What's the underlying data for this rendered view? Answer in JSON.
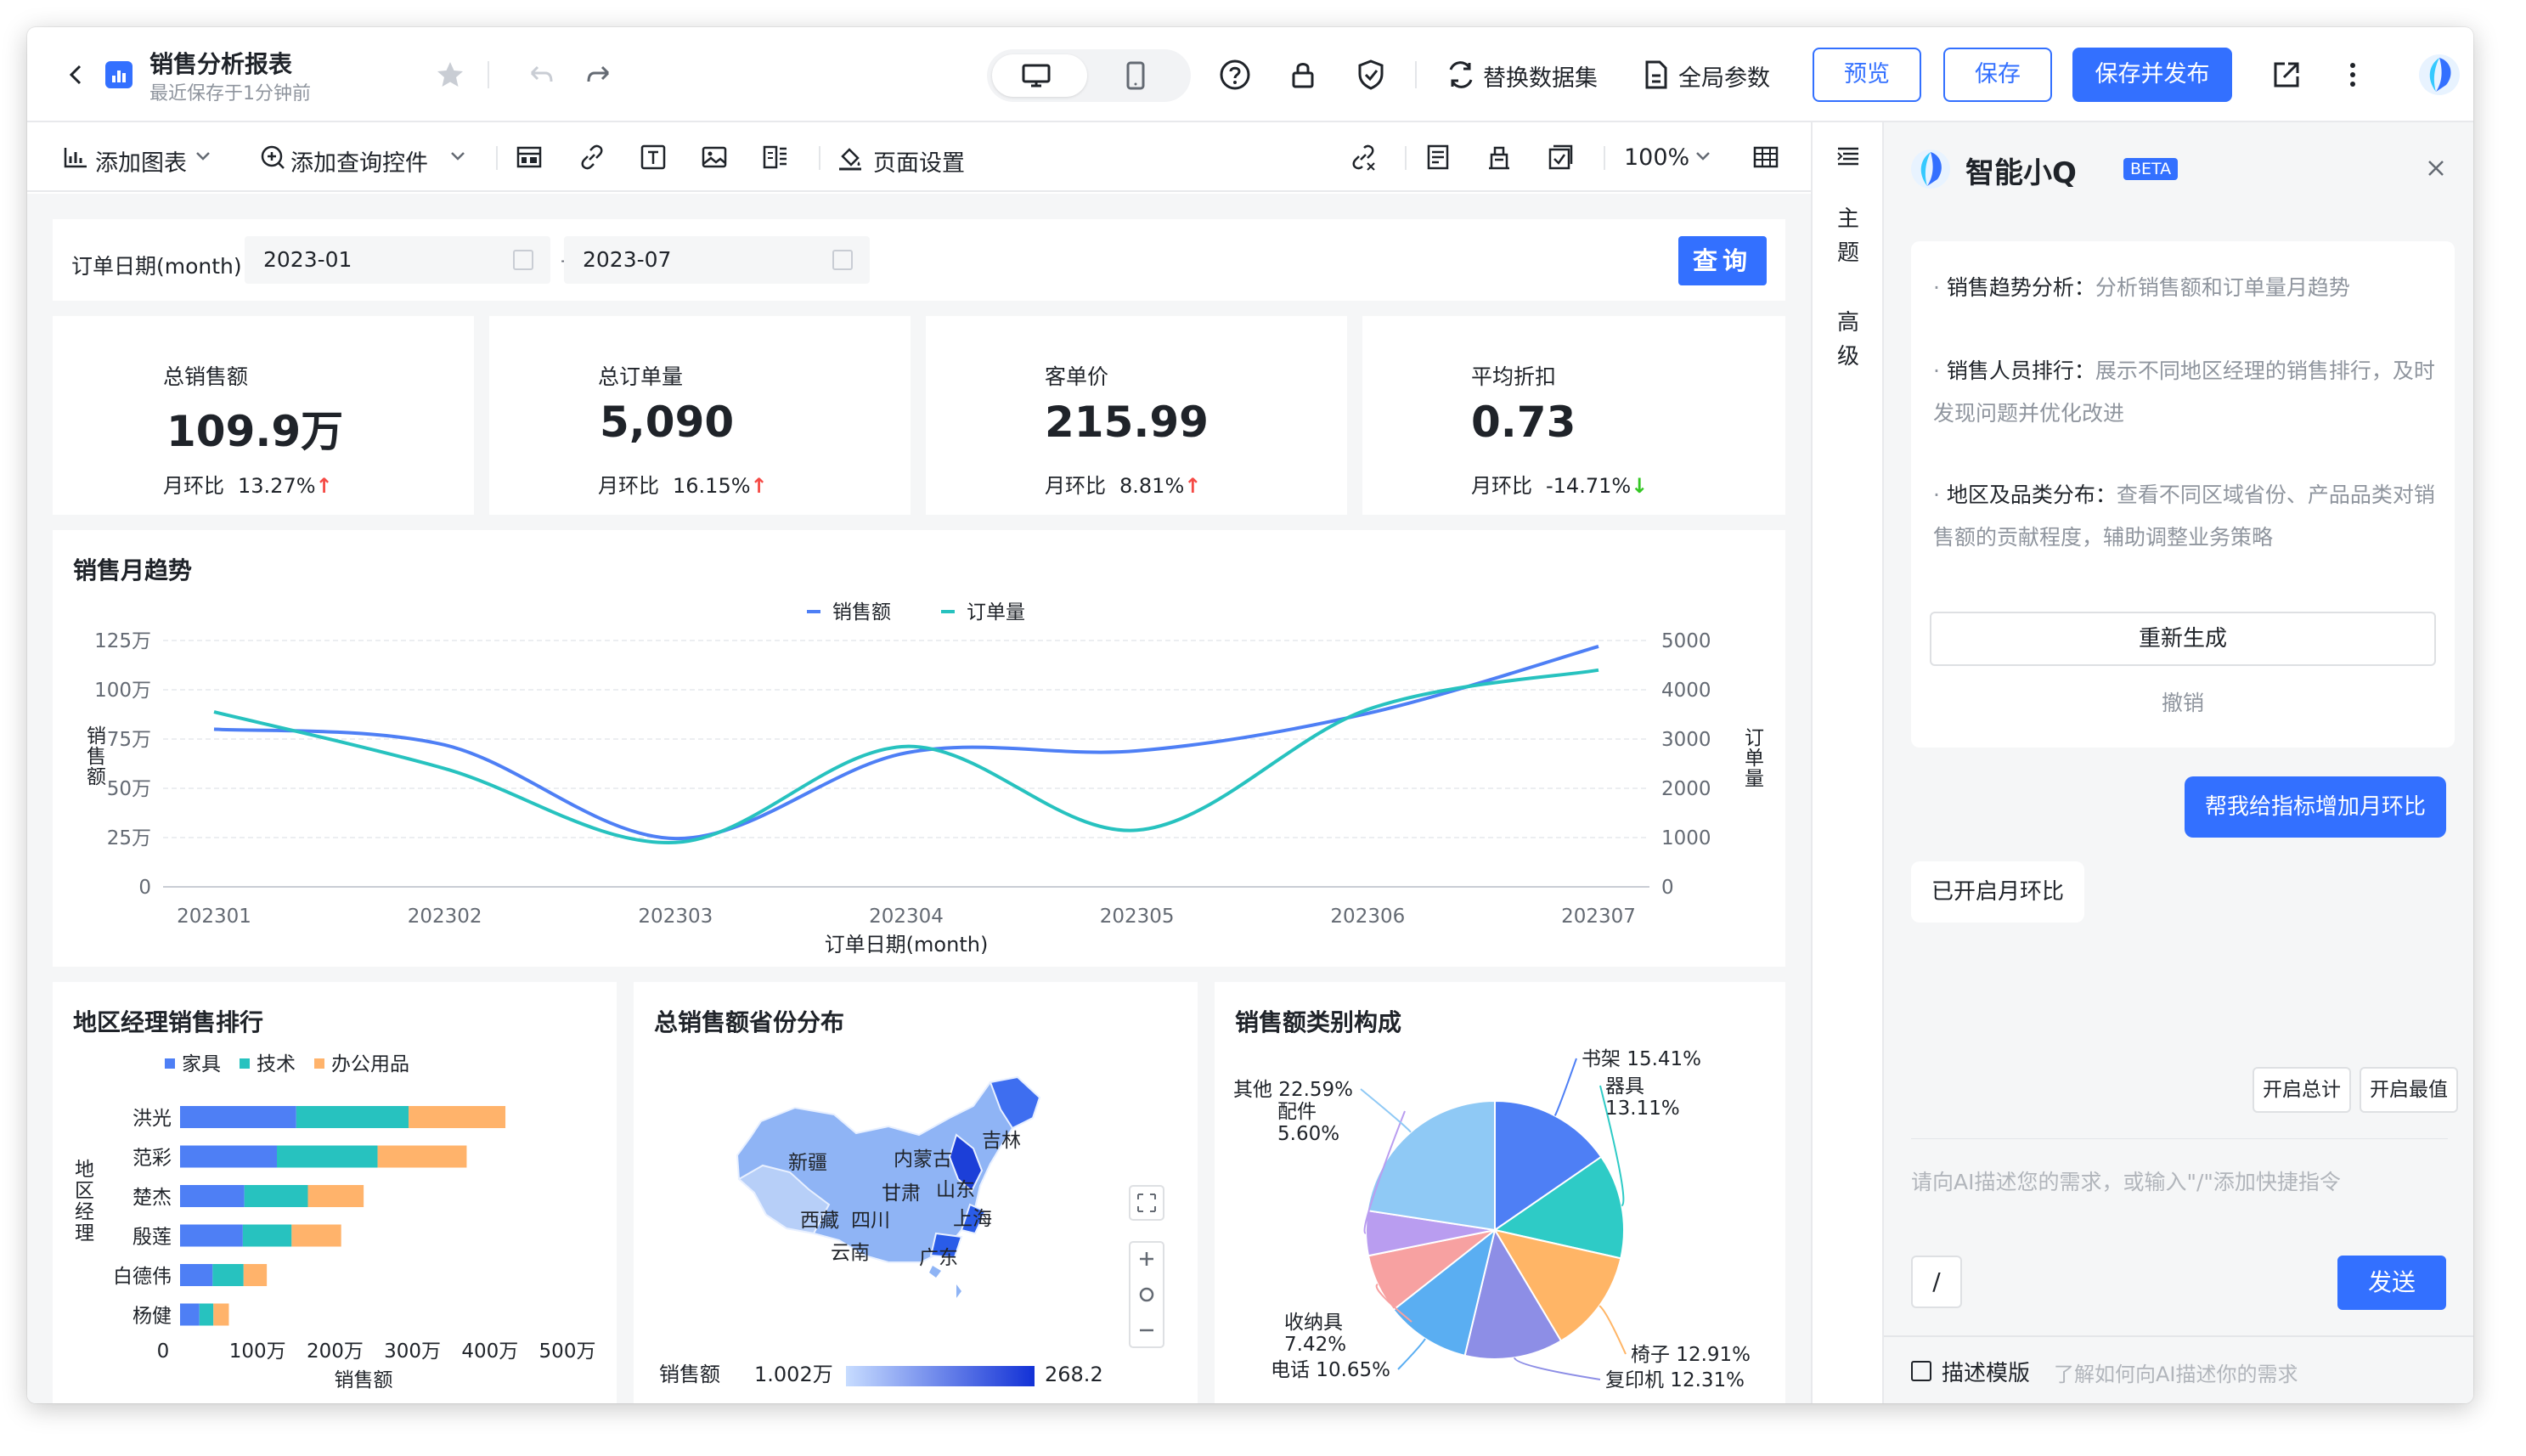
{
  "header": {
    "title": "销售分析报表",
    "subtitle": "最近保存于1分钟前",
    "replace_dataset": "替换数据集",
    "global_params": "全局参数",
    "preview": "预览",
    "save": "保存",
    "save_publish": "保存并发布"
  },
  "toolbar": {
    "add_chart": "添加图表",
    "add_query": "添加查询控件",
    "page_settings": "页面设置",
    "zoom": "100%"
  },
  "filter": {
    "label": "订单日期(month)",
    "start": "2023-01",
    "sep": "-",
    "end": "2023-07",
    "query": "查询"
  },
  "kpis": [
    {
      "title": "总销售额",
      "value": "109.9万",
      "mom_label": "月环比",
      "mom": "13.27%",
      "trend": "up"
    },
    {
      "title": "总订单量",
      "value": "5,090",
      "mom_label": "月环比",
      "mom": "16.15%",
      "trend": "up"
    },
    {
      "title": "客单价",
      "value": "215.99",
      "mom_label": "月环比",
      "mom": "8.81%",
      "trend": "up"
    },
    {
      "title": "平均折扣",
      "value": "0.73",
      "mom_label": "月环比",
      "mom": "-14.71%",
      "trend": "down"
    }
  ],
  "trend_card": {
    "title": "销售月趋势"
  },
  "rank_card": {
    "title": "地区经理销售排行"
  },
  "map_card": {
    "title": "总销售额省份分布",
    "legend_label": "销售额",
    "min": "1.002万",
    "max": "268.2",
    "regions": [
      "新疆",
      "内蒙古",
      "吉林",
      "甘肃",
      "山东",
      "西藏",
      "四川",
      "上海",
      "云南",
      "广东"
    ]
  },
  "pie_card": {
    "title": "销售额类别构成"
  },
  "colors": {
    "accent": "#3370ff",
    "series_blue": "#4e7ff5",
    "series_teal": "#27c2bf",
    "series_orange": "#ffb36b"
  },
  "chart_data": [
    {
      "type": "line",
      "title": "销售月趋势",
      "x": [
        "202301",
        "202302",
        "202303",
        "202304",
        "202305",
        "202306",
        "202307"
      ],
      "xlabel": "订单日期(month)",
      "series": [
        {
          "name": "销售额",
          "axis": "left",
          "values": [
            800000,
            720000,
            245000,
            680000,
            690000,
            880000,
            1220000
          ]
        },
        {
          "name": "订单量",
          "axis": "right",
          "values": [
            3550,
            2400,
            900,
            2850,
            1150,
            3600,
            4400
          ]
        }
      ],
      "ylabel_left": "销售额",
      "ylabel_right": "订单量",
      "yticks_left": [
        "0",
        "25万",
        "50万",
        "75万",
        "100万",
        "125万"
      ],
      "yticks_right": [
        "0",
        "1000",
        "2000",
        "3000",
        "4000",
        "5000"
      ],
      "ylim_left": [
        0,
        1250000
      ],
      "ylim_right": [
        0,
        5000
      ],
      "legend": "top-center"
    },
    {
      "type": "bar",
      "orientation": "horizontal-stacked",
      "title": "地区经理销售排行",
      "categories": [
        "洪光",
        "范彩",
        "楚杰",
        "殷莲",
        "白德伟",
        "杨健"
      ],
      "series": [
        {
          "name": "家具",
          "values": [
            1500000,
            1250000,
            830000,
            810000,
            420000,
            250000
          ]
        },
        {
          "name": "技术",
          "values": [
            1450000,
            1300000,
            820000,
            630000,
            400000,
            180000
          ]
        },
        {
          "name": "办公用品",
          "values": [
            1250000,
            1150000,
            720000,
            640000,
            300000,
            200000
          ]
        }
      ],
      "xlabel": "销售额",
      "ylabel": "地区经理",
      "xticks": [
        "0",
        "100万",
        "200万",
        "300万",
        "400万",
        "500万"
      ],
      "xlim": [
        0,
        5000000
      ],
      "legend": "top"
    },
    {
      "type": "pie",
      "title": "销售额类别构成",
      "slices": [
        {
          "label": "书架",
          "value": 15.41
        },
        {
          "label": "器具",
          "value": 13.11
        },
        {
          "label": "椅子",
          "value": 12.91
        },
        {
          "label": "复印机",
          "value": 12.31
        },
        {
          "label": "电话",
          "value": 10.65
        },
        {
          "label": "收纳具",
          "value": 7.42
        },
        {
          "label": "配件",
          "value": 5.6
        },
        {
          "label": "其他",
          "value": 22.59
        }
      ]
    }
  ],
  "rail": {
    "theme": "主题",
    "advanced": "高级"
  },
  "ai_panel": {
    "title": "智能小Q",
    "badge": "BETA",
    "suggestions": [
      {
        "head": "销售趋势分析：",
        "body": "分析销售额和订单量月趋势"
      },
      {
        "head": "销售人员排行：",
        "body": "展示不同地区经理的销售排行，及时发现问题并优化改进"
      },
      {
        "head": "地区及品类分布：",
        "body": "查看不同区域省份、产品品类对销售额的贡献程度，辅助调整业务策略"
      }
    ],
    "regenerate": "重新生成",
    "undo": "撤销",
    "user_msg": "帮我给指标增加月环比",
    "ai_msg": "已开启月环比",
    "chip1": "开启总计",
    "chip2": "开启最值",
    "input_placeholder": "请向AI描述您的需求，或输入\"/\"添加快捷指令",
    "slash": "/",
    "send": "发送",
    "footer_label": "描述模版",
    "footer_hint": "了解如何向AI描述你的需求"
  }
}
